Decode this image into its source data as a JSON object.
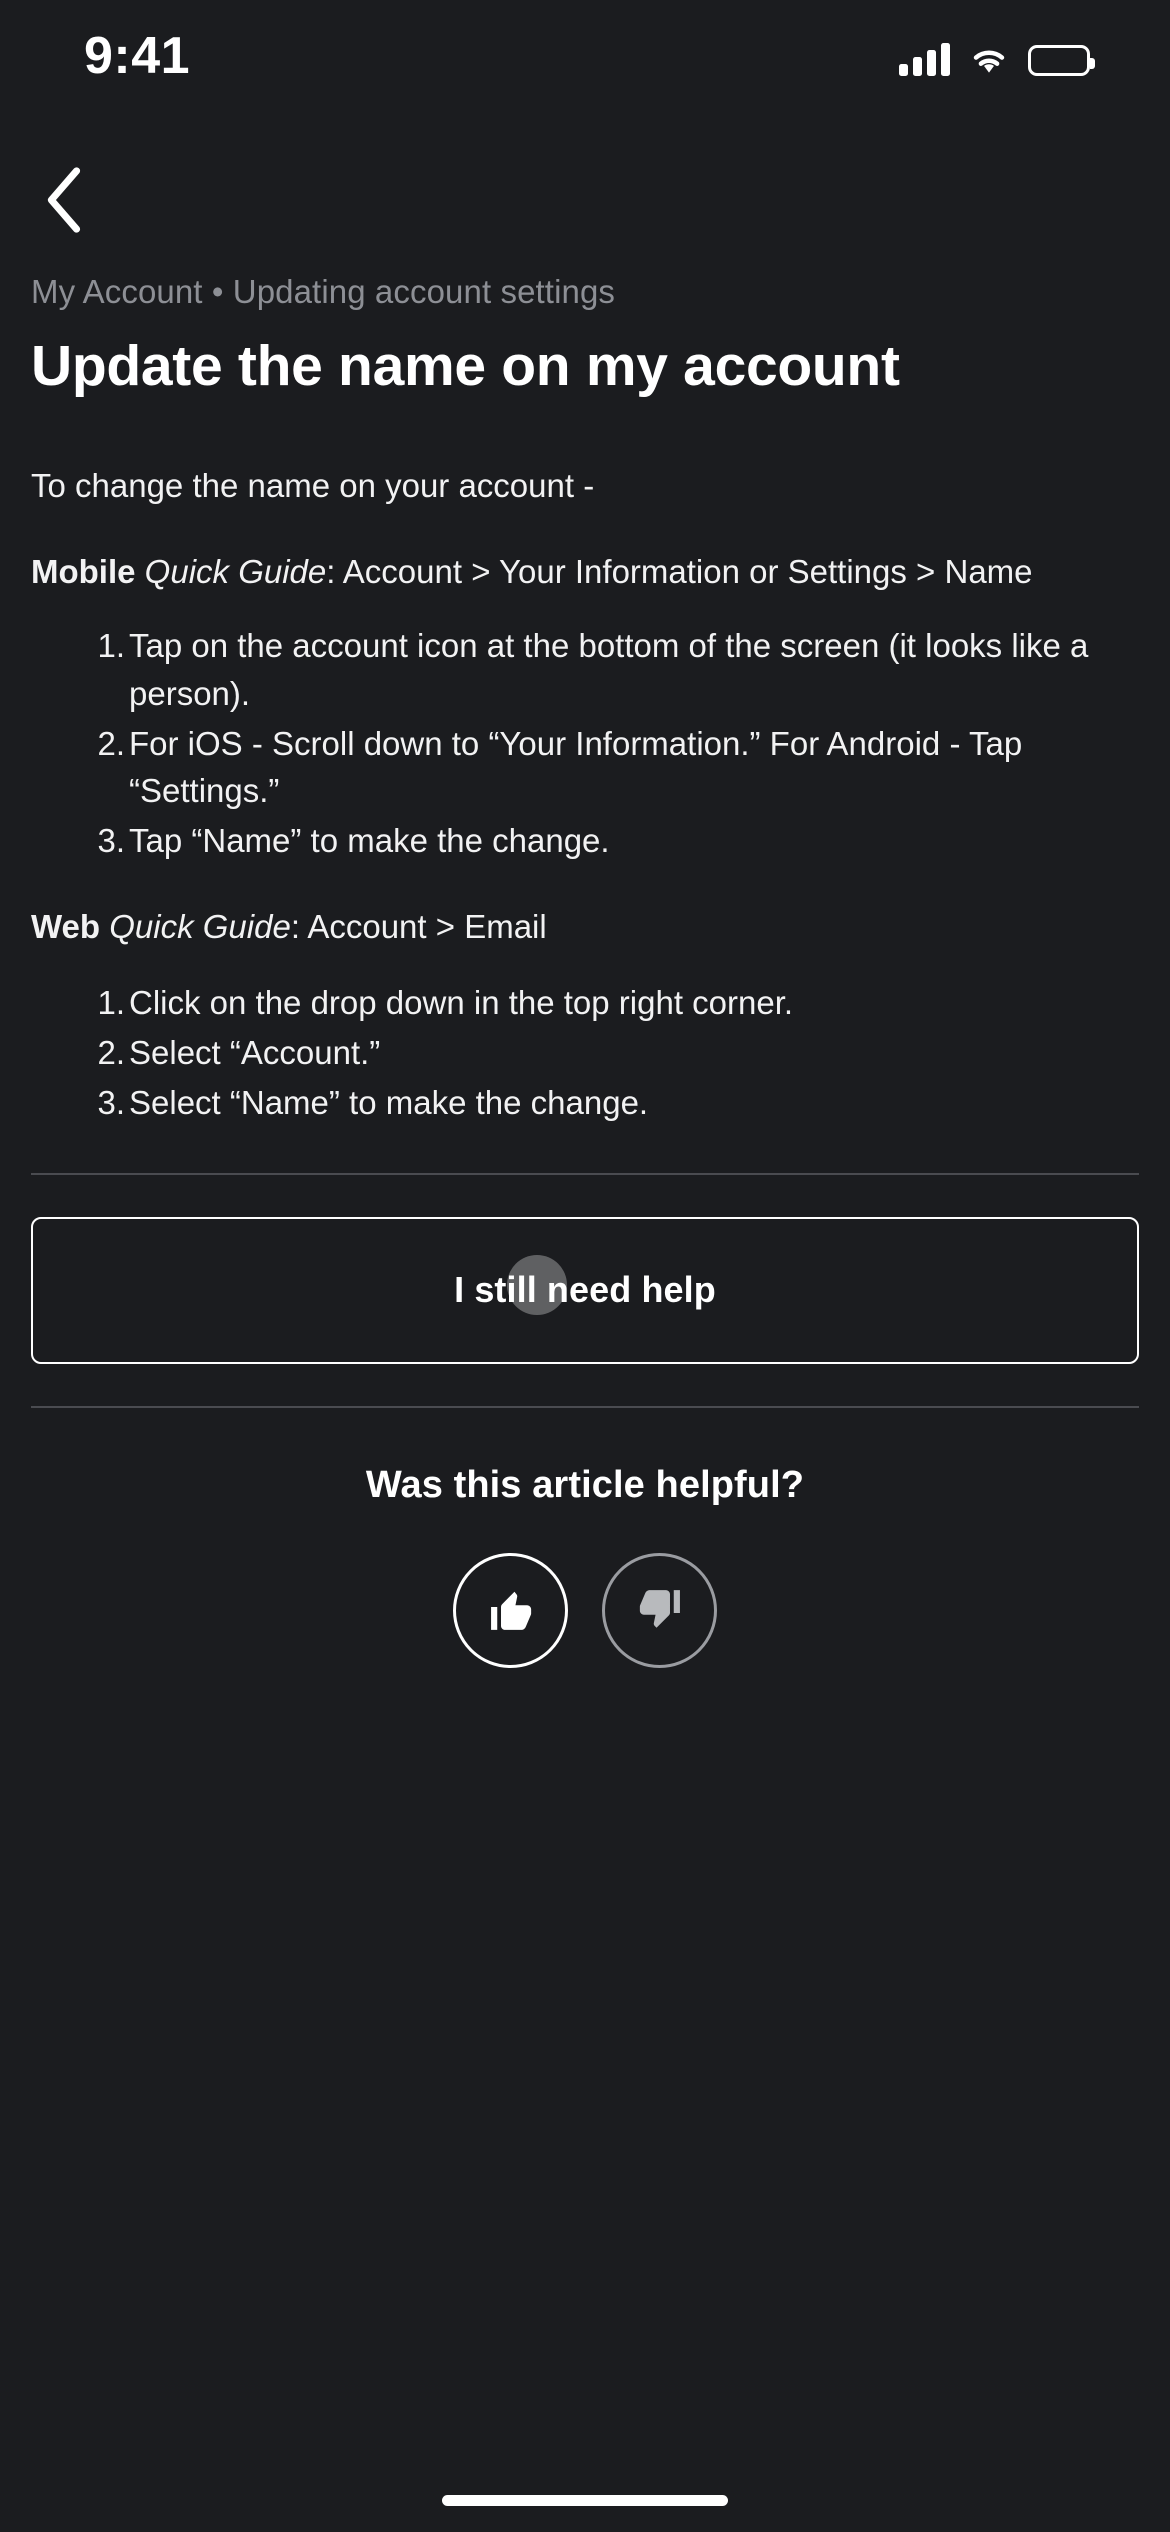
{
  "status_bar": {
    "time": "9:41",
    "cellular_icon": "cellular-bars-icon",
    "wifi_icon": "wifi-icon",
    "battery_icon": "battery-full-icon"
  },
  "nav": {
    "back_icon": "chevron-left-icon"
  },
  "article": {
    "breadcrumb": "My Account • Updating account settings",
    "title": "Update the name on my account",
    "intro": "To change the name on your account -",
    "sections": [
      {
        "platform": "Mobile",
        "guide_label": "Quick Guide",
        "path": ": Account > Your Information or Settings > Name",
        "steps": [
          {
            "num": "1.",
            "text": "Tap on the account icon at the bottom of the screen (it looks like a person)."
          },
          {
            "num": "2.",
            "text": "For iOS - Scroll down to “Your Information.” For Android - Tap  “Settings.”"
          },
          {
            "num": "3.",
            "text": "   Tap “Name” to make the change."
          }
        ]
      },
      {
        "platform": "Web",
        "guide_label": "Quick Guide",
        "path": ": Account > Email",
        "steps": [
          {
            "num": "1.",
            "text": "Click on the drop down in the top right corner."
          },
          {
            "num": "2.",
            "text": "   Select “Account.”"
          },
          {
            "num": "3.",
            "text": "Select “Name” to make the change."
          }
        ]
      }
    ]
  },
  "help_button": {
    "label": "I still need help"
  },
  "feedback": {
    "question": "Was this article helpful?",
    "thumbs_up_icon": "thumbs-up-icon",
    "thumbs_down_icon": "thumbs-down-icon"
  },
  "colors": {
    "background": "#1b1c1f",
    "text_primary": "#f2f2f3",
    "text_muted": "#8d8f95",
    "divider": "#4a4b50",
    "border_accent": "#ffffff",
    "thumb_down": "#9a9ca1"
  }
}
